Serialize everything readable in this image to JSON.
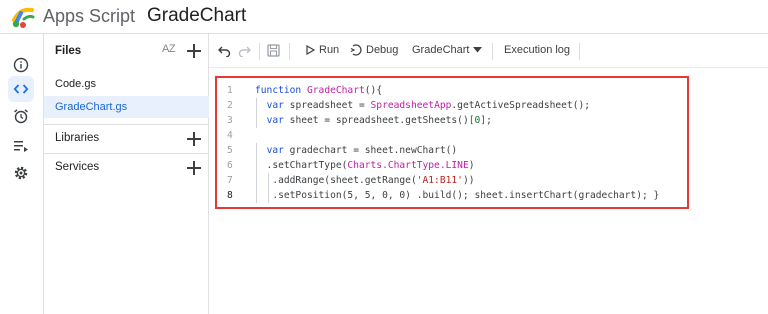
{
  "header": {
    "app_name": "Apps Script",
    "project_title": "GradeChart"
  },
  "rail": {
    "items": [
      {
        "icon": "info-icon"
      },
      {
        "icon": "code-editor-icon",
        "active": true
      },
      {
        "icon": "triggers-alarm-icon"
      },
      {
        "icon": "executions-icon"
      },
      {
        "icon": "settings-gear-icon"
      }
    ]
  },
  "files": {
    "title": "Files",
    "sort_label": "AZ",
    "items": [
      {
        "name": "Code.gs",
        "selected": false
      },
      {
        "name": "GradeChart.gs",
        "selected": true
      }
    ],
    "libraries_label": "Libraries",
    "services_label": "Services"
  },
  "toolbar": {
    "run_label": "Run",
    "debug_label": "Debug",
    "function_select": "GradeChart",
    "execution_log_label": "Execution log"
  },
  "editor": {
    "current_line": 8,
    "lines": [
      {
        "n": "1",
        "text": "function GradeChart(){"
      },
      {
        "n": "2",
        "text": "  var spreadsheet = SpreadsheetApp.getActiveSpreadsheet();"
      },
      {
        "n": "3",
        "text": "  var sheet = spreadsheet.getSheets()[0];"
      },
      {
        "n": "4",
        "text": ""
      },
      {
        "n": "5",
        "text": "  var gradechart = sheet.newChart()"
      },
      {
        "n": "6",
        "text": "  .setChartType(Charts.ChartType.LINE)"
      },
      {
        "n": "7",
        "text": "   .addRange(sheet.getRange('A1:B11'))"
      },
      {
        "n": "8",
        "text": "   .setPosition(5, 5, 0, 0) .build(); sheet.insertChart(gradechart); }"
      }
    ]
  },
  "colors": {
    "accent": "#1a73e8",
    "selection_bg": "#e8f0fe",
    "highlight_border": "#e53935",
    "keyword": "#1a4fd1",
    "class_name": "#c01ea8",
    "string": "#b3261e"
  }
}
